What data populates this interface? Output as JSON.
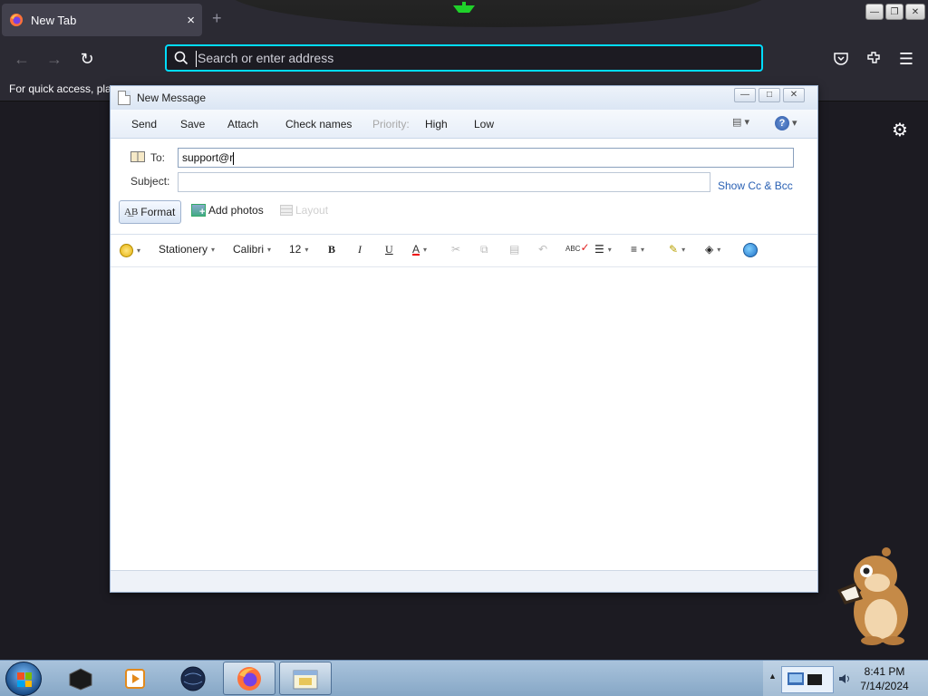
{
  "browser": {
    "tab": {
      "title": "New Tab",
      "close": "×"
    },
    "new_tab": "+",
    "address_placeholder": "Search or enter address",
    "bookmarks_hint": "For quick access, plac"
  },
  "compose": {
    "title": "New Message",
    "menu": {
      "send": "Send",
      "save": "Save",
      "attach": "Attach",
      "check_names": "Check names",
      "priority": "Priority:",
      "high": "High",
      "low": "Low",
      "help": "?"
    },
    "to_label": "To:",
    "to_value": "support@r",
    "subject_label": "Subject:",
    "subject_value": "",
    "show_cc_bcc": "Show Cc & Bcc",
    "format": "Format",
    "add_photos": "Add photos",
    "layout": "Layout",
    "toolbar": {
      "stationery": "Stationery",
      "font": "Calibri",
      "size": "12",
      "bold": "B",
      "italic": "I",
      "underline": "U",
      "font_color": "A",
      "spell": "ABC"
    },
    "body": ""
  },
  "taskbar": {
    "time": "8:41 PM",
    "date": "7/14/2024"
  }
}
